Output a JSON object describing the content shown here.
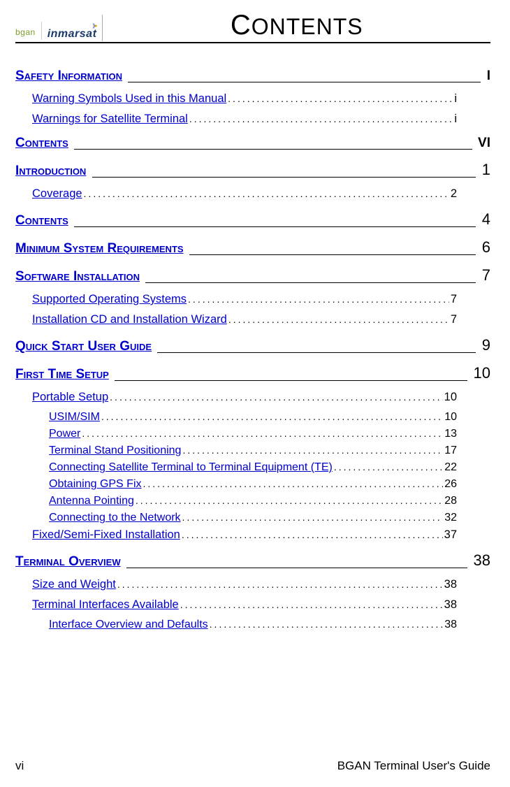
{
  "logo_left": "bgan",
  "logo_right": "inmarsat",
  "title": "Contents",
  "toc": [
    {
      "level": 1,
      "label": "Safety Information",
      "page": "I",
      "sc": true
    },
    {
      "level": 2,
      "label": "Warning Symbols Used in this Manual",
      "page": "i"
    },
    {
      "level": 2,
      "label": "Warnings for Satellite Terminal",
      "page": "i"
    },
    {
      "level": 1,
      "label": "Contents",
      "page": "VI",
      "sc": true
    },
    {
      "level": 1,
      "label": "Introduction",
      "page": "1"
    },
    {
      "level": 2,
      "label": "Coverage",
      "page": "2"
    },
    {
      "level": 1,
      "label": "Contents",
      "page": "4"
    },
    {
      "level": 1,
      "label": "Minimum System Requirements",
      "page": "6"
    },
    {
      "level": 1,
      "label": "Software Installation",
      "page": "7"
    },
    {
      "level": 2,
      "label": "Supported Operating Systems",
      "page": "7"
    },
    {
      "level": 2,
      "label": "Installation CD and Installation Wizard",
      "page": "7"
    },
    {
      "level": 1,
      "label": "Quick Start User Guide",
      "page": "9"
    },
    {
      "level": 1,
      "label": "First Time Setup",
      "page": "10"
    },
    {
      "level": 2,
      "label": "Portable Setup",
      "page": "10"
    },
    {
      "level": 3,
      "label": "USIM/SIM",
      "page": "10"
    },
    {
      "level": 3,
      "label": "Power",
      "page": "13"
    },
    {
      "level": 3,
      "label": "Terminal Stand Positioning",
      "page": "17"
    },
    {
      "level": 3,
      "label": "Connecting Satellite Terminal to Terminal Equipment (TE)",
      "page": "22"
    },
    {
      "level": 3,
      "label": "Obtaining GPS Fix",
      "page": "26"
    },
    {
      "level": 3,
      "label": "Antenna Pointing",
      "page": "28"
    },
    {
      "level": 3,
      "label": "Connecting to the Network",
      "page": "32"
    },
    {
      "level": 2,
      "label": "Fixed/Semi-Fixed Installation",
      "page": "37"
    },
    {
      "level": 1,
      "label": "Terminal Overview",
      "page": "38"
    },
    {
      "level": 2,
      "label": "Size and Weight",
      "page": "38"
    },
    {
      "level": 2,
      "label": "Terminal Interfaces Available",
      "page": "38"
    },
    {
      "level": 3,
      "label": "Interface Overview and Defaults",
      "page": "38"
    }
  ],
  "footer_left": "vi",
  "footer_right": "BGAN Terminal User's Guide"
}
